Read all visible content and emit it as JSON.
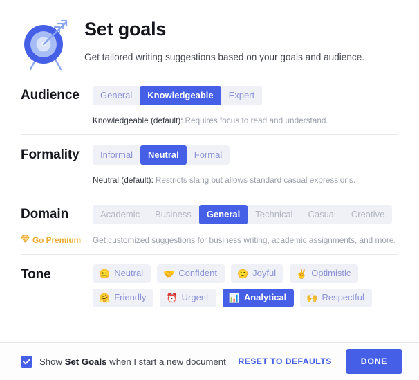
{
  "header": {
    "icon": "target-with-arrow-icon",
    "title": "Set goals",
    "subtitle": "Get tailored writing suggestions based on your goals and audience."
  },
  "sections": {
    "audience": {
      "label": "Audience",
      "options": [
        "General",
        "Knowledgeable",
        "Expert"
      ],
      "selected": "Knowledgeable",
      "help_strong": "Knowledgeable (default):",
      "help_text": "Requires focus to read and understand."
    },
    "formality": {
      "label": "Formality",
      "options": [
        "Informal",
        "Neutral",
        "Formal"
      ],
      "selected": "Neutral",
      "help_strong": "Neutral (default):",
      "help_text": "Restricts slang but allows standard casual expressions."
    },
    "domain": {
      "label": "Domain",
      "options": [
        "Academic",
        "Business",
        "General",
        "Technical",
        "Casual",
        "Creative"
      ],
      "selected": "General",
      "disabled_options": [
        "Academic",
        "Business",
        "Technical",
        "Casual",
        "Creative"
      ],
      "premium_icon": "gem-icon",
      "premium_label": "Go Premium",
      "help_text": "Get customized suggestions for business writing, academic assignments, and more."
    },
    "tone": {
      "label": "Tone",
      "selected": "Analytical",
      "chips": [
        {
          "emoji": "😐",
          "emoji_name": "neutral-face-emoji",
          "label": "Neutral"
        },
        {
          "emoji": "🤝",
          "emoji_name": "handshake-emoji",
          "label": "Confident"
        },
        {
          "emoji": "🙂",
          "emoji_name": "slightly-smiling-face-emoji",
          "label": "Joyful"
        },
        {
          "emoji": "✌️",
          "emoji_name": "victory-hand-emoji",
          "label": "Optimistic"
        },
        {
          "emoji": "🤗",
          "emoji_name": "hugging-face-emoji",
          "label": "Friendly"
        },
        {
          "emoji": "⏰",
          "emoji_name": "alarm-clock-emoji",
          "label": "Urgent"
        },
        {
          "emoji": "📊",
          "emoji_name": "bar-chart-emoji",
          "label": "Analytical"
        },
        {
          "emoji": "🙌",
          "emoji_name": "raising-hands-emoji",
          "label": "Respectful"
        }
      ]
    }
  },
  "footer": {
    "checkbox_checked": true,
    "checkbox_label_prefix": "Show ",
    "checkbox_label_bold": "Set Goals",
    "checkbox_label_suffix": " when I start a new document",
    "reset_label": "RESET TO DEFAULTS",
    "done_label": "DONE"
  },
  "colors": {
    "accent": "#4560e6",
    "chip_bg": "#f0f1f7",
    "chip_text": "#8c93d6",
    "disabled_text": "#b4b8c2",
    "premium": "#edab33"
  }
}
